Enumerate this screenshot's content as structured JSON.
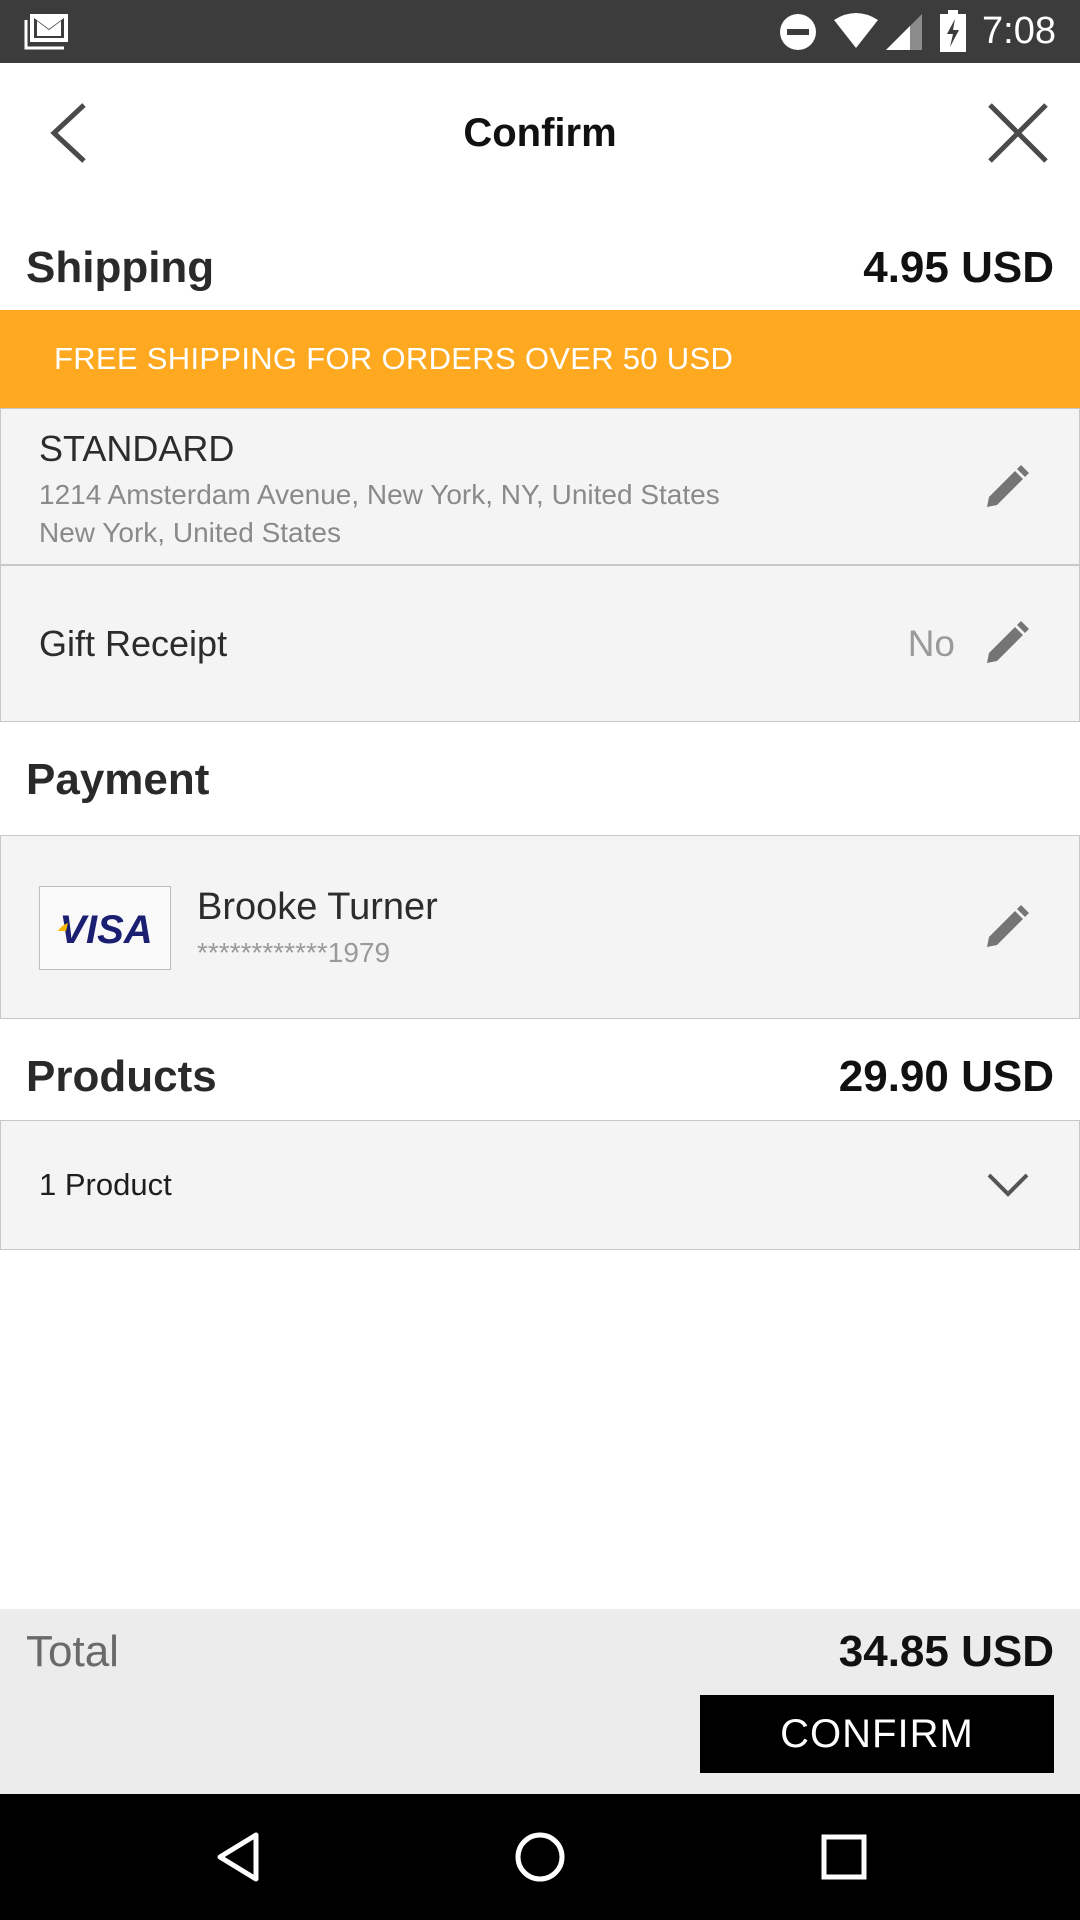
{
  "status_bar": {
    "time": "7:08",
    "icons": [
      "gmail-icon",
      "do-not-disturb-icon",
      "wifi-icon",
      "cell-signal-icon",
      "battery-charging-icon"
    ]
  },
  "header": {
    "title": "Confirm",
    "back_icon": "chevron-left-icon",
    "close_icon": "close-icon"
  },
  "shipping": {
    "label": "Shipping",
    "amount": "4.95 USD",
    "banner": "FREE SHIPPING FOR ORDERS OVER 50 USD",
    "method": "STANDARD",
    "address_line1": "1214 Amsterdam Avenue, New York, NY, United States",
    "address_line2": "New York, United States",
    "edit_icon": "pencil-icon"
  },
  "gift_receipt": {
    "label": "Gift Receipt",
    "value": "No",
    "edit_icon": "pencil-icon"
  },
  "payment": {
    "label": "Payment",
    "card_brand": "VISA",
    "card_holder": "Brooke Turner",
    "card_number": "************1979",
    "edit_icon": "pencil-icon"
  },
  "products": {
    "label": "Products",
    "amount": "29.90 USD",
    "count_label": "1 Product",
    "expand_icon": "chevron-down-icon"
  },
  "footer": {
    "total_label": "Total",
    "total_amount": "34.85 USD",
    "confirm_label": "CONFIRM"
  },
  "nav_bar": {
    "icons": [
      "back-triangle-icon",
      "home-circle-icon",
      "recents-square-icon"
    ]
  },
  "colors": {
    "banner": "#ffa921",
    "status_bar": "#3c3c3c",
    "card_bg": "#f4f4f4",
    "footer_bg": "#ececec",
    "visa_blue": "#1a1f71",
    "visa_gold": "#f7b600"
  }
}
